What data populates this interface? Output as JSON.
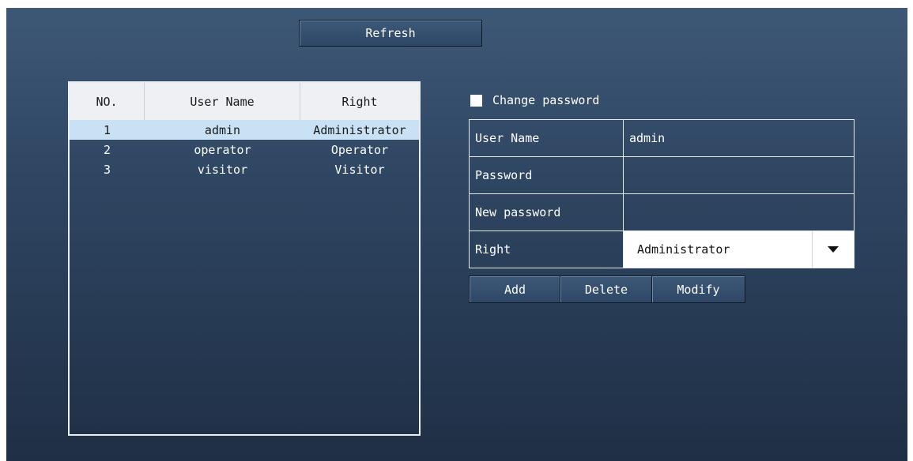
{
  "toolbar": {
    "refresh_label": "Refresh"
  },
  "user_table": {
    "headers": [
      "NO.",
      "User Name",
      "Right"
    ],
    "rows": [
      {
        "no": "1",
        "user": "admin",
        "right": "Administrator",
        "selected": true
      },
      {
        "no": "2",
        "user": "operator",
        "right": "Operator"
      },
      {
        "no": "3",
        "user": "visitor",
        "right": "Visitor"
      }
    ]
  },
  "change_password": {
    "label": "Change password",
    "checked": false
  },
  "form": {
    "user_name_label": "User Name",
    "user_name_value": "admin",
    "password_label": "Password",
    "password_value": "",
    "new_password_label": "New password",
    "new_password_value": "",
    "right_label": "Right",
    "right_value": "Administrator"
  },
  "actions": {
    "add_label": "Add",
    "delete_label": "Delete",
    "modify_label": "Modify"
  },
  "colors": {
    "panel_top": "#3d5876",
    "panel_bottom": "#1f2f45",
    "selected_row": "#c9e1f4",
    "header_bg": "#eef0f3"
  }
}
